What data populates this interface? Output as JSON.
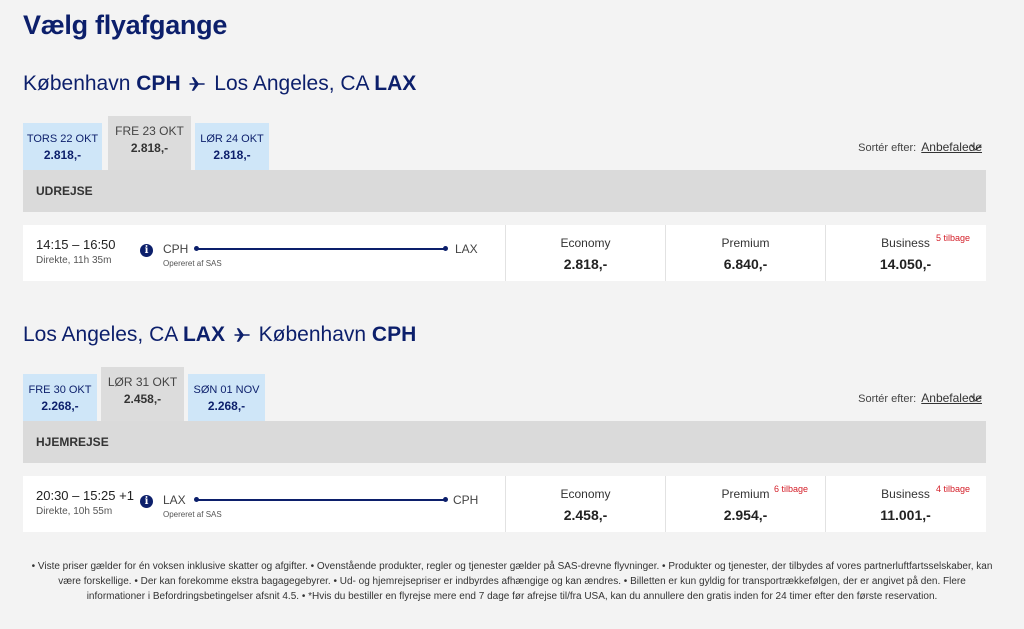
{
  "page": {
    "title": "Vælg flyafgange"
  },
  "outbound": {
    "route": {
      "from_city": "København",
      "from_code": "CPH",
      "to_city": "Los Angeles, CA",
      "to_code": "LAX"
    },
    "dates": [
      {
        "day": "TORS 22 OKT",
        "price": "2.818,-"
      },
      {
        "day": "FRE 23 OKT",
        "price": "2.818,-",
        "selected": true
      },
      {
        "day": "LØR 24 OKT",
        "price": "2.818,-"
      }
    ],
    "sort": {
      "label": "Sortér efter:",
      "value": "Anbefalede"
    },
    "section_label": "UDREJSE",
    "flight": {
      "time": "14:15 – 16:50",
      "duration": "Direkte, 11h 35m",
      "from": "CPH",
      "to": "LAX",
      "operated": "Opereret af SAS",
      "cabins": [
        {
          "name": "Economy",
          "price": "2.818,-",
          "seats": ""
        },
        {
          "name": "Premium",
          "price": "6.840,-",
          "seats": ""
        },
        {
          "name": "Business",
          "price": "14.050,-",
          "seats": "5 tilbage"
        }
      ]
    }
  },
  "inbound": {
    "route": {
      "from_city": "Los Angeles, CA",
      "from_code": "LAX",
      "to_city": "København",
      "to_code": "CPH"
    },
    "dates": [
      {
        "day": "FRE 30 OKT",
        "price": "2.268,-"
      },
      {
        "day": "LØR 31 OKT",
        "price": "2.458,-",
        "selected": true
      },
      {
        "day": "SØN 01 NOV",
        "price": "2.268,-"
      }
    ],
    "sort": {
      "label": "Sortér efter:",
      "value": "Anbefalede"
    },
    "section_label": "HJEMREJSE",
    "flight": {
      "time": "20:30 – 15:25 +1",
      "duration": "Direkte, 10h 55m",
      "from": "LAX",
      "to": "CPH",
      "operated": "Opereret af SAS",
      "cabins": [
        {
          "name": "Economy",
          "price": "2.458,-",
          "seats": ""
        },
        {
          "name": "Premium",
          "price": "2.954,-",
          "seats": "6 tilbage"
        },
        {
          "name": "Business",
          "price": "11.001,-",
          "seats": "4 tilbage"
        }
      ]
    }
  },
  "footer": {
    "text": "• Viste priser gælder for én voksen inklusive skatter og afgifter. • Ovenstående produkter, regler og tjenester gælder på SAS-drevne flyvninger. • Produkter og tjenester, der tilbydes af vores partnerluftfartsselskaber, kan være forskellige. • Der kan forekomme ekstra bagagegebyrer. • Ud- og hjemrejsepriser er indbyrdes afhængige og kan ændres. • Billetten er kun gyldig for transportrækkefølgen, der er angivet på den. Flere informationer i Befordringsbetingelser afsnit 4.5. • *Hvis du bestiller en flyrejse mere end 7 dage før afrejse til/fra USA, kan du annullere den gratis inden for 24 timer efter den første reservation."
  },
  "colors": {
    "brand": "#0c1f6b",
    "tab": "#cfe6f8",
    "active_tab": "#dcdcdc",
    "alert": "#d4202a"
  }
}
